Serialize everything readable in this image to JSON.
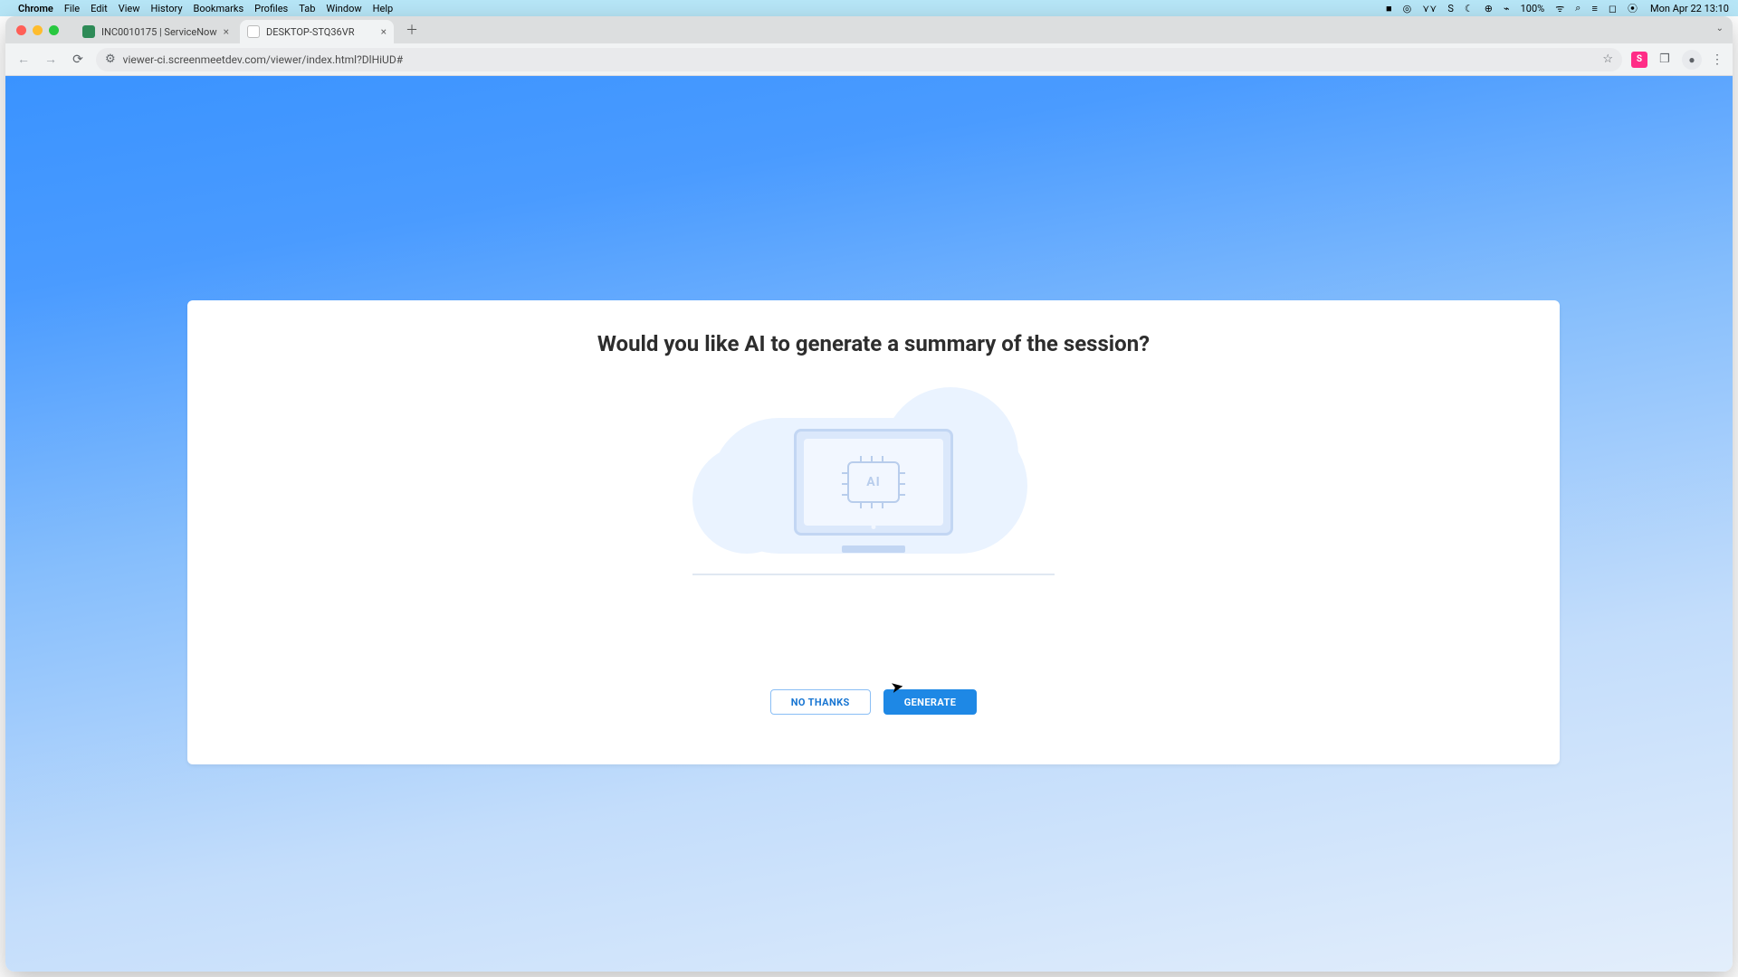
{
  "menubar": {
    "app": "Chrome",
    "items": [
      "File",
      "Edit",
      "View",
      "History",
      "Bookmarks",
      "Profiles",
      "Tab",
      "Window",
      "Help"
    ],
    "clock": "Mon Apr 22  13:10",
    "status_icons": [
      "■",
      "◎",
      "⋎⋎",
      "S",
      "☾",
      "⊕",
      "⌁",
      "100%",
      "ᯤ",
      "⌕",
      "≡",
      "◻",
      "⦿"
    ]
  },
  "browser": {
    "tabs": [
      {
        "title": "INC0010175 | ServiceNow",
        "active": false
      },
      {
        "title": "DESKTOP-STQ36VR",
        "active": true
      }
    ],
    "url": "viewer-ci.screenmeetdev.com/viewer/index.html?DlHiUD#"
  },
  "dialog": {
    "heading": "Would you like AI to generate a summary of the session?",
    "chip_label": "AI",
    "no_label": "NO THANKS",
    "yes_label": "GENERATE"
  }
}
